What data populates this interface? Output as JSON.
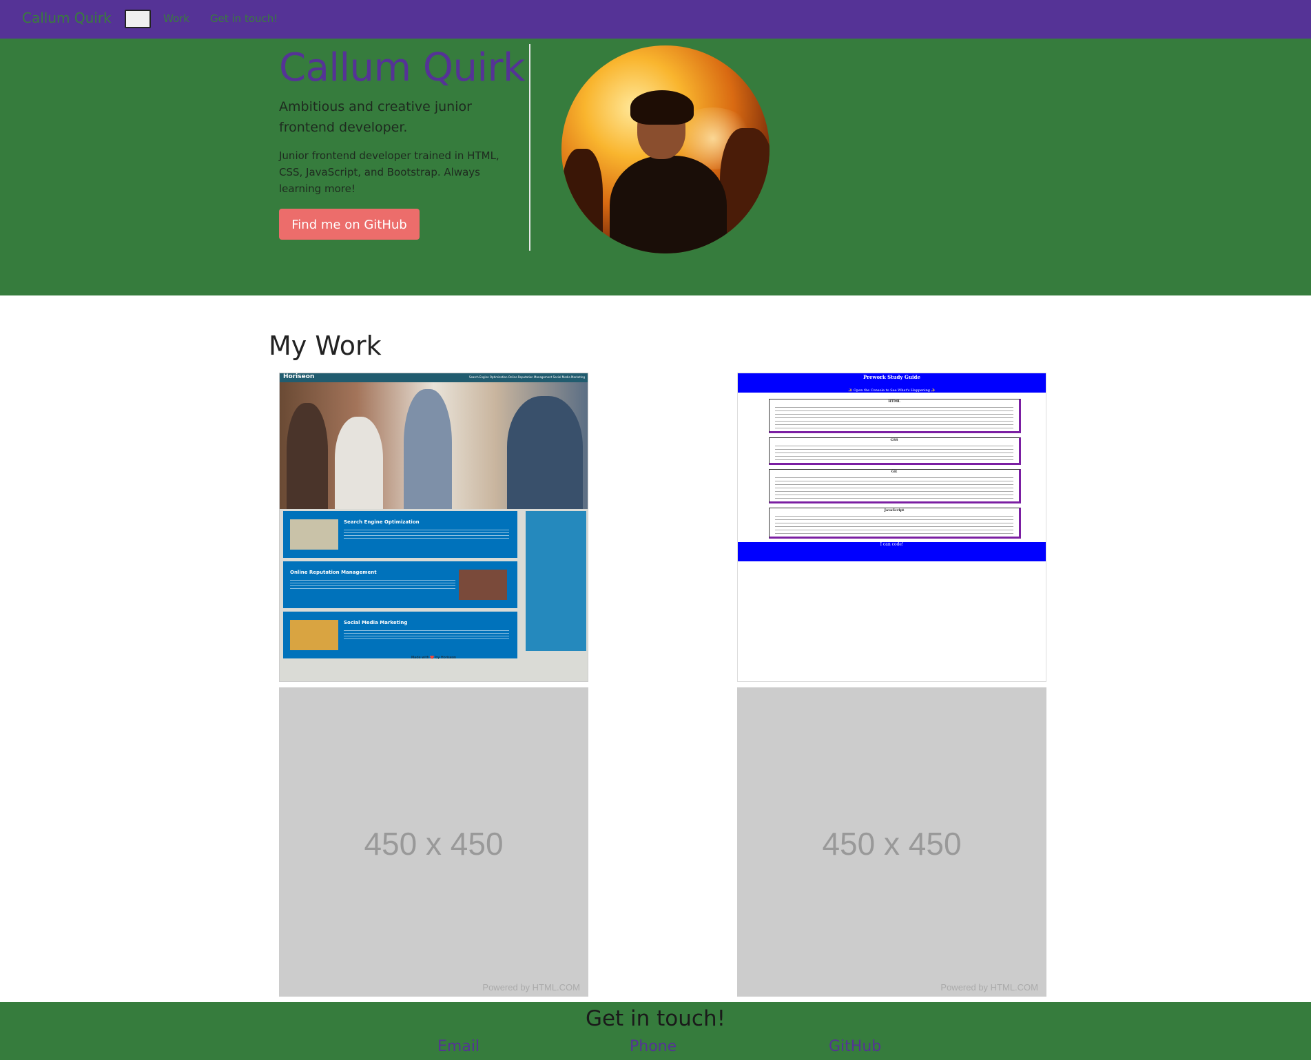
{
  "nav": {
    "brand": "Callum Quirk",
    "links": [
      "Work",
      "Get in touch!"
    ]
  },
  "hero": {
    "title": "Callum Quirk",
    "lead": "Ambitious and creative junior frontend developer.",
    "description": "Junior frontend developer trained in HTML, CSS, JavaScript, and Bootstrap. Always learning more!",
    "button": "Find me on GitHub"
  },
  "work": {
    "title": "My Work",
    "horiseon": {
      "brand": "Horiseon",
      "nav": "Search Engine Optimization   Online Reputation Management   Social Media Marketing",
      "items": [
        "Search Engine Optimization",
        "Online Reputation Management",
        "Social Media Marketing"
      ],
      "footer": "Made with ❤️ by Horiseon"
    },
    "prework": {
      "title": "Prework Study Guide",
      "subtitle": "✨ Open the Console to See What's Happening ✨",
      "sections": [
        "HTML",
        "CSS",
        "Git",
        "JavaScript"
      ],
      "footer": "I can code!"
    },
    "placeholders": [
      {
        "size": "450 x 450",
        "powered": "Powered by HTML.COM"
      },
      {
        "size": "450 x 450",
        "powered": "Powered by HTML.COM"
      }
    ]
  },
  "footer": {
    "title": "Get in touch!",
    "links": [
      "Email",
      "Phone",
      "GitHub"
    ]
  },
  "colors": {
    "nav_bg": "#553396",
    "hero_bg": "#367c3d",
    "accent_button": "#ec6d6b",
    "title_purple": "#553396"
  }
}
